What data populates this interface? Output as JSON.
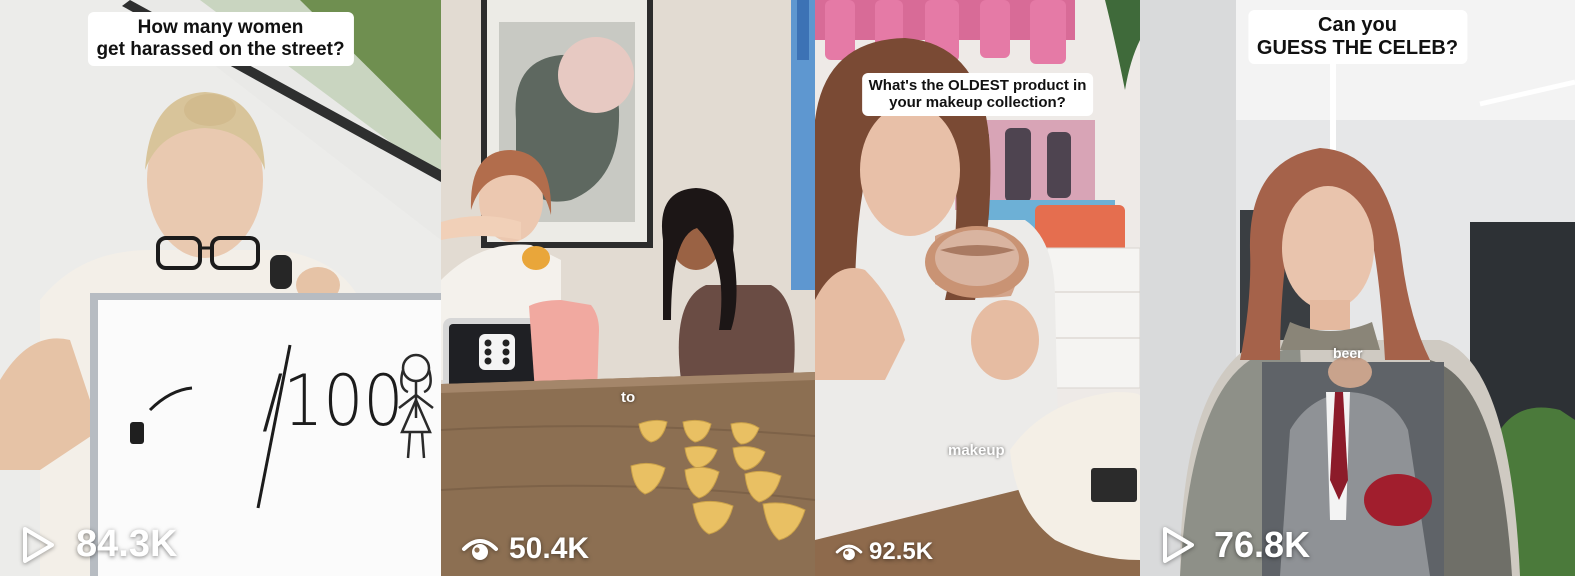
{
  "videos": [
    {
      "caption": [
        "How many women",
        "get harassed on the street?"
      ],
      "board_text": "/100",
      "view_icon": "play-icon",
      "views": "84.3K"
    },
    {
      "overlay_word": "to",
      "view_icon": "eye-icon",
      "views": "50.4K"
    },
    {
      "caption": [
        "What's the OLDEST product in",
        "your makeup collection?"
      ],
      "overlay_word": "makeup",
      "view_icon": "eye-icon",
      "views": "92.5K"
    },
    {
      "caption": [
        "Can you",
        "GUESS THE CELEB?"
      ],
      "overlay_word": "beer",
      "view_icon": "play-icon",
      "views": "76.8K"
    }
  ]
}
